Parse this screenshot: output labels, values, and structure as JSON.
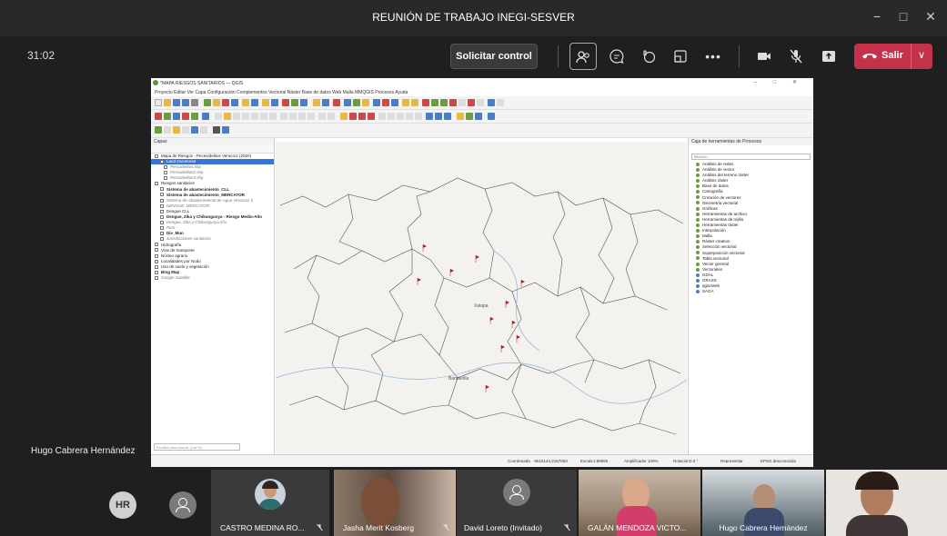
{
  "window": {
    "title": "REUNIÓN DE TRABAJO INEGI-SESVER",
    "minimize": "−",
    "maximize": "□",
    "close": "✕"
  },
  "controls": {
    "timer": "31:02",
    "request_control": "Solicitar control",
    "leave": "Salir",
    "leave_caret": "∨",
    "icons": [
      "participants-icon",
      "chat-icon",
      "reactions-icon",
      "rooms-icon",
      "more-icon",
      "camera-icon",
      "mic-off-icon",
      "share-icon",
      "phone-icon"
    ]
  },
  "qgis": {
    "title": "*MAPA RIESGOS SANITARIOS — QGIS",
    "menu": "Proyecto  Editar  Ver  Capa  Configuración  Complementos  Vectorial  Ráster  Base de datos  Web  Malla  MMQGIS  Procesos  Ayuda",
    "layers_title": "Capas",
    "layers": [
      {
        "label": "Mapa de Riesgos - Peces/delitos Veracruz (2020)",
        "style": ""
      },
      {
        "label": "Land Inventorial",
        "style": "sel"
      },
      {
        "label": "Pescadelitos.shp",
        "style": "it"
      },
      {
        "label": "Pescadelitos2.shp",
        "style": "it"
      },
      {
        "label": "Pescadelitos3.shp",
        "style": "it"
      },
      {
        "label": "Riesgos sanitarios",
        "style": ""
      },
      {
        "label": "Sistema de abastecimiento_CLL",
        "style": "b"
      },
      {
        "label": "Sistema de abastecimiento_MERCATOR",
        "style": "b"
      },
      {
        "label": "Sistema de Abastecimiento de Agua Veracruz (i",
        "style": "it"
      },
      {
        "label": "DENGUE_MERCATOR",
        "style": "it"
      },
      {
        "label": "Dengue CLL",
        "style": ""
      },
      {
        "label": "Dengue, Zika y Chikungunya - Riesgo Medio-Alto",
        "style": "b"
      },
      {
        "label": "Dengue, Zika y Chikungunya.shx",
        "style": "it"
      },
      {
        "label": "Rios",
        "style": "it"
      },
      {
        "label": "Div_Mun",
        "style": "b"
      },
      {
        "label": "Jurisdicciones sanitarias",
        "style": "it"
      },
      {
        "label": "Hidrografía",
        "style": ""
      },
      {
        "label": "Vías de transporte",
        "style": ""
      },
      {
        "label": "Núcleo agrario",
        "style": ""
      },
      {
        "label": "Localidades por Nodo",
        "style": ""
      },
      {
        "label": "Uso de suelo y vegetación",
        "style": ""
      },
      {
        "label": "Bing Map",
        "style": "b"
      },
      {
        "label": "Google Satellite",
        "style": "it"
      }
    ],
    "toolbox_title": "Caja de herramientas de Procesos",
    "toolbox_search": "Buscar...",
    "toolbox": [
      "Análisis de redes",
      "Análisis de vector",
      "Análisis del terreno ráster",
      "Análisis ráster",
      "Base de datos",
      "Cartografía",
      "Creación de vectores",
      "Geometría vectorial",
      "Gráficas",
      "Herramientas de archivo",
      "Herramientas de rejilla",
      "Herramientas ráster",
      "Interpolación",
      "Malla",
      "Ráster creation",
      "Selección vectorial",
      "Superposición vectorial",
      "Tabla vectorial",
      "Vector general",
      "Vectoriales",
      "GDAL",
      "GRASS",
      "qgis2web",
      "SAGA"
    ],
    "map_labels": [
      "Xalapa",
      "Banderilla"
    ],
    "search_locator": "Escriba para buscar (Ctrl+K)",
    "status": {
      "coord_label": "Coordenada",
      "coord": "-9616144,2157053",
      "scale_label": "Escala",
      "scale": "1:88660",
      "mag_label": "Amplificador",
      "mag": "100%",
      "rot_label": "Rotación",
      "rot": "0.0 °",
      "render": "Representar",
      "crs": "EPSG desconocido"
    }
  },
  "presenter": "Hugo Cabrera Hernández",
  "participants": [
    {
      "initials": "HR"
    },
    {
      "name": "CASTRO MEDINA RO..."
    },
    {
      "name": "Jasha Merit Kosberg"
    },
    {
      "name": "David Loreto (Invitado)"
    },
    {
      "name": "GALÁN MENDOZA VICTO..."
    },
    {
      "name": "Hugo Cabrera Hernández"
    }
  ]
}
